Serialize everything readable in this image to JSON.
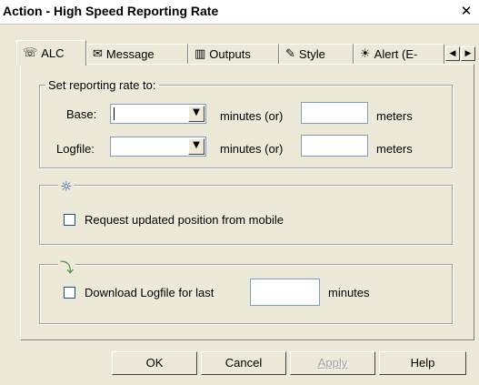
{
  "window": {
    "title": "Action - High Speed Reporting Rate",
    "close_glyph": "✕"
  },
  "tabs": [
    {
      "label": "ALC",
      "icon": "phone-icon",
      "glyph": "☏"
    },
    {
      "label": "Message",
      "icon": "envelope-icon",
      "glyph": "✉"
    },
    {
      "label": "Outputs",
      "icon": "outputs-icon",
      "glyph": "▥"
    },
    {
      "label": "Style",
      "icon": "pin-icon",
      "glyph": "✎"
    },
    {
      "label": "Alert (E-",
      "icon": "alert-icon",
      "glyph": "☀"
    }
  ],
  "tab_scroll": {
    "left": "◀",
    "right": "▶"
  },
  "reporting": {
    "legend": "Set reporting rate to:",
    "base_label": "Base:",
    "base_value": "",
    "logfile_label": "Logfile:",
    "logfile_value": "",
    "minutes_or": "minutes (or)",
    "meters": "meters",
    "drop_glyph": "▼"
  },
  "position": {
    "icon": "locate-mobile-icon",
    "icon_glyph": "☼",
    "checkbox_label": "Request updated position from mobile",
    "checked": false
  },
  "download": {
    "icon": "download-icon",
    "icon_glyph": "⤵",
    "checkbox_label": "Download Logfile for last",
    "minutes_label": "minutes",
    "value": "",
    "checked": false
  },
  "buttons": {
    "ok": "OK",
    "cancel": "Cancel",
    "apply": "Apply",
    "help": "Help"
  }
}
